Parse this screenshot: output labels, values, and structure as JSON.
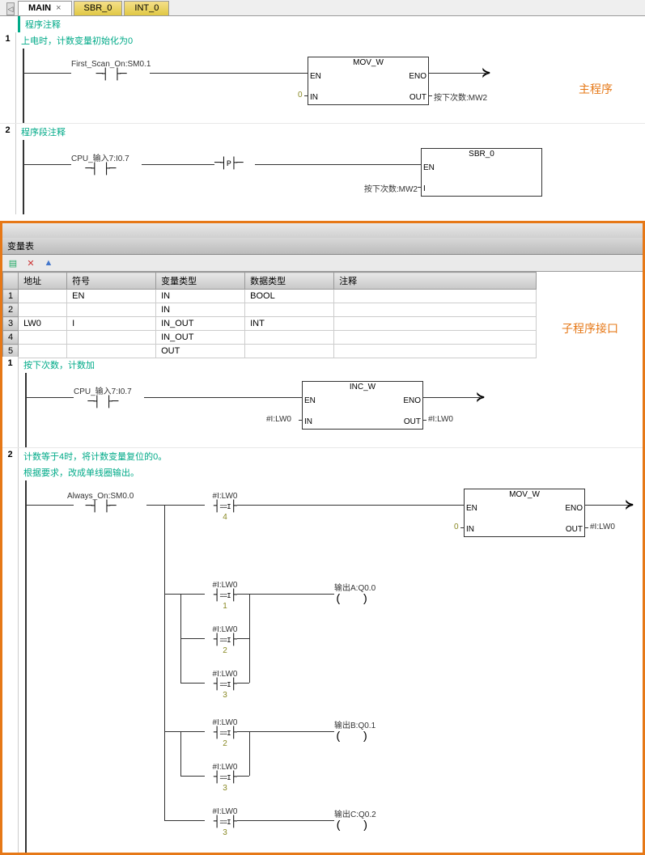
{
  "tabs": {
    "nav": "◁",
    "main": "MAIN",
    "sbr": "SBR_0",
    "int": "INT_0"
  },
  "main": {
    "prog_comment": "程序注释",
    "net1": {
      "comment": "上电时，计数变量初始化为0",
      "contact": "First_Scan_On:SM0.1",
      "block": "MOV_W",
      "en": "EN",
      "eno": "ENO",
      "in": "IN",
      "out": "OUT",
      "in_val": "0",
      "out_val": "按下次数:MW2"
    },
    "net2": {
      "comment": "程序段注释",
      "contact": "CPU_输入7:I0.7",
      "p": "P",
      "block": "SBR_0",
      "en": "EN",
      "i": "I",
      "i_val": "按下次数:MW2"
    },
    "label": "主程序"
  },
  "sub": {
    "var_title": "变量表",
    "headers": {
      "addr": "地址",
      "sym": "符号",
      "vtype": "变量类型",
      "dtype": "数据类型",
      "comment": "注释"
    },
    "rows": [
      {
        "n": "1",
        "addr": "",
        "sym": "EN",
        "vt": "IN",
        "dt": "BOOL",
        "c": ""
      },
      {
        "n": "2",
        "addr": "",
        "sym": "",
        "vt": "IN",
        "dt": "",
        "c": ""
      },
      {
        "n": "3",
        "addr": "LW0",
        "sym": "I",
        "vt": "IN_OUT",
        "dt": "INT",
        "c": ""
      },
      {
        "n": "4",
        "addr": "",
        "sym": "",
        "vt": "IN_OUT",
        "dt": "",
        "c": ""
      },
      {
        "n": "5",
        "addr": "",
        "sym": "",
        "vt": "OUT",
        "dt": "",
        "c": ""
      }
    ],
    "label": "子程序接口",
    "net1": {
      "comment": "按下次数，计数加",
      "contact": "CPU_输入7:I0.7",
      "block": "INC_W",
      "en": "EN",
      "eno": "ENO",
      "in": "IN",
      "out": "OUT",
      "in_val": "#I:LW0",
      "out_val": "#I:LW0"
    },
    "net2": {
      "comment1": "计数等于4时，将计数变量复位的0。",
      "comment2": "根据要求，改成单线圈输出。",
      "contact": "Always_On:SM0.0",
      "cmp_op": "==I",
      "lw0": "#I:LW0",
      "v4": "4",
      "v1": "1",
      "v2": "2",
      "v3": "3",
      "mov": "MOV_W",
      "en": "EN",
      "eno": "ENO",
      "in": "IN",
      "out": "OUT",
      "in_val": "0",
      "out_val": "#I:LW0",
      "outA": "输出A:Q0.0",
      "outB": "输出B:Q0.1",
      "outC": "输出C:Q0.2"
    }
  }
}
